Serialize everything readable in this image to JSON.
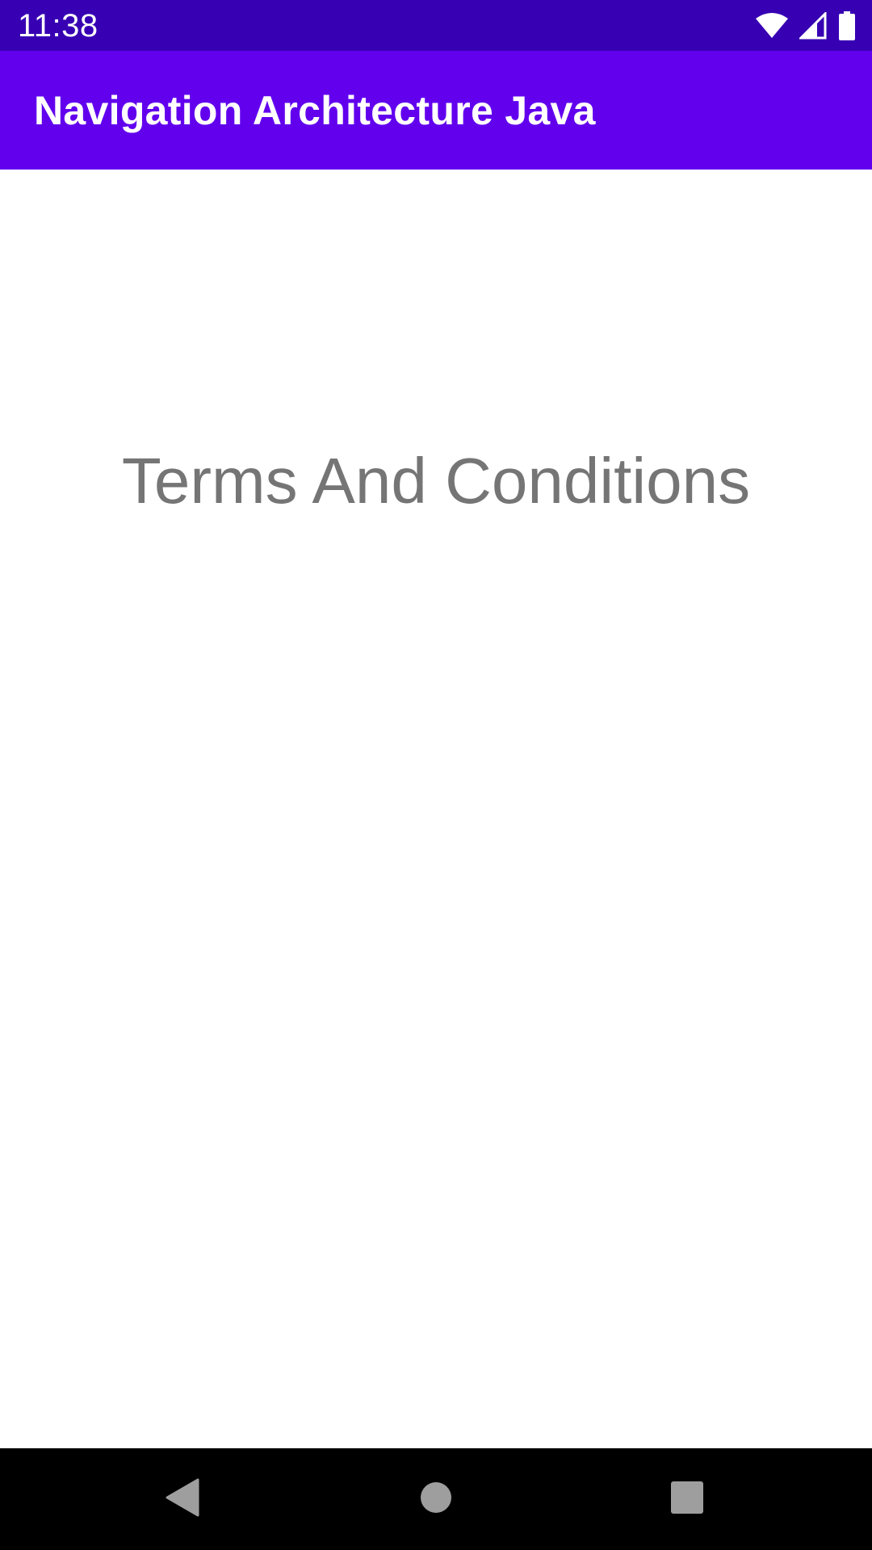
{
  "status_bar": {
    "time": "11:38",
    "background": "#3700b3",
    "icons": [
      "wifi-icon",
      "cell-signal-icon",
      "battery-icon"
    ]
  },
  "app_bar": {
    "title": "Navigation Architecture Java",
    "background": "#6200ee"
  },
  "content": {
    "text": "Terms And Conditions",
    "text_color": "#757575"
  },
  "nav_bar": {
    "buttons": [
      "back-icon",
      "home-icon",
      "recents-icon"
    ],
    "icon_color": "#9e9e9e"
  }
}
